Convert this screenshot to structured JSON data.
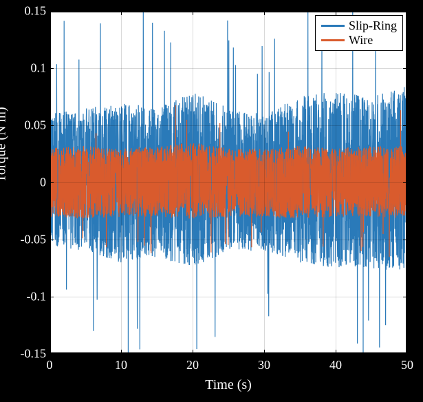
{
  "chart_data": {
    "type": "line",
    "title": "",
    "xlabel": "Time (s)",
    "ylabel": "Torque (N m)",
    "xlim": [
      0,
      50
    ],
    "ylim": [
      -0.15,
      0.15
    ],
    "xticks": [
      0,
      10,
      20,
      30,
      40,
      50
    ],
    "yticks": [
      -0.15,
      -0.1,
      -0.05,
      0,
      0.05,
      0.1,
      0.15
    ],
    "ytick_labels": [
      "-0.15",
      "-0.1",
      "-0.05",
      "0",
      "0.05",
      "0.1",
      "0.15"
    ],
    "grid": true,
    "legend": {
      "position": "top-right",
      "entries": [
        "Slip-Ring",
        "Wire"
      ]
    },
    "series": [
      {
        "name": "Slip-Ring",
        "color": "#1f77b4",
        "description": "Highly noisy torque signal, dense oscillation spanning roughly −0.06 to +0.06 N·m with frequent spikes near ±0.10 and occasional extreme spikes approaching ±0.13; slight low-frequency envelope modulation (broader around 35–45 s).",
        "approx_envelope": {
          "t": [
            0,
            5,
            10,
            15,
            20,
            25,
            30,
            35,
            40,
            45,
            50
          ],
          "lo": [
            -0.055,
            -0.06,
            -0.07,
            -0.065,
            -0.075,
            -0.06,
            -0.06,
            -0.07,
            -0.075,
            -0.075,
            -0.08
          ],
          "hi": [
            0.06,
            0.065,
            0.07,
            0.065,
            0.08,
            0.065,
            0.06,
            0.075,
            0.08,
            0.075,
            0.085
          ]
        }
      },
      {
        "name": "Wire",
        "color": "#d95b2d",
        "description": "Noisy torque signal centered at 0, narrower band mostly between −0.03 and +0.03 N·m with occasional spikes to roughly ±0.05.",
        "approx_envelope": {
          "t": [
            0,
            5,
            10,
            15,
            20,
            25,
            30,
            35,
            40,
            45,
            50
          ],
          "lo": [
            -0.03,
            -0.032,
            -0.03,
            -0.03,
            -0.032,
            -0.03,
            -0.03,
            -0.032,
            -0.03,
            -0.03,
            -0.032
          ],
          "hi": [
            0.03,
            0.032,
            0.03,
            0.032,
            0.035,
            0.03,
            0.03,
            0.032,
            0.03,
            0.032,
            0.032
          ]
        }
      }
    ]
  },
  "colors": {
    "slip_ring": "#2a7ab9",
    "wire": "#d95b2d"
  }
}
